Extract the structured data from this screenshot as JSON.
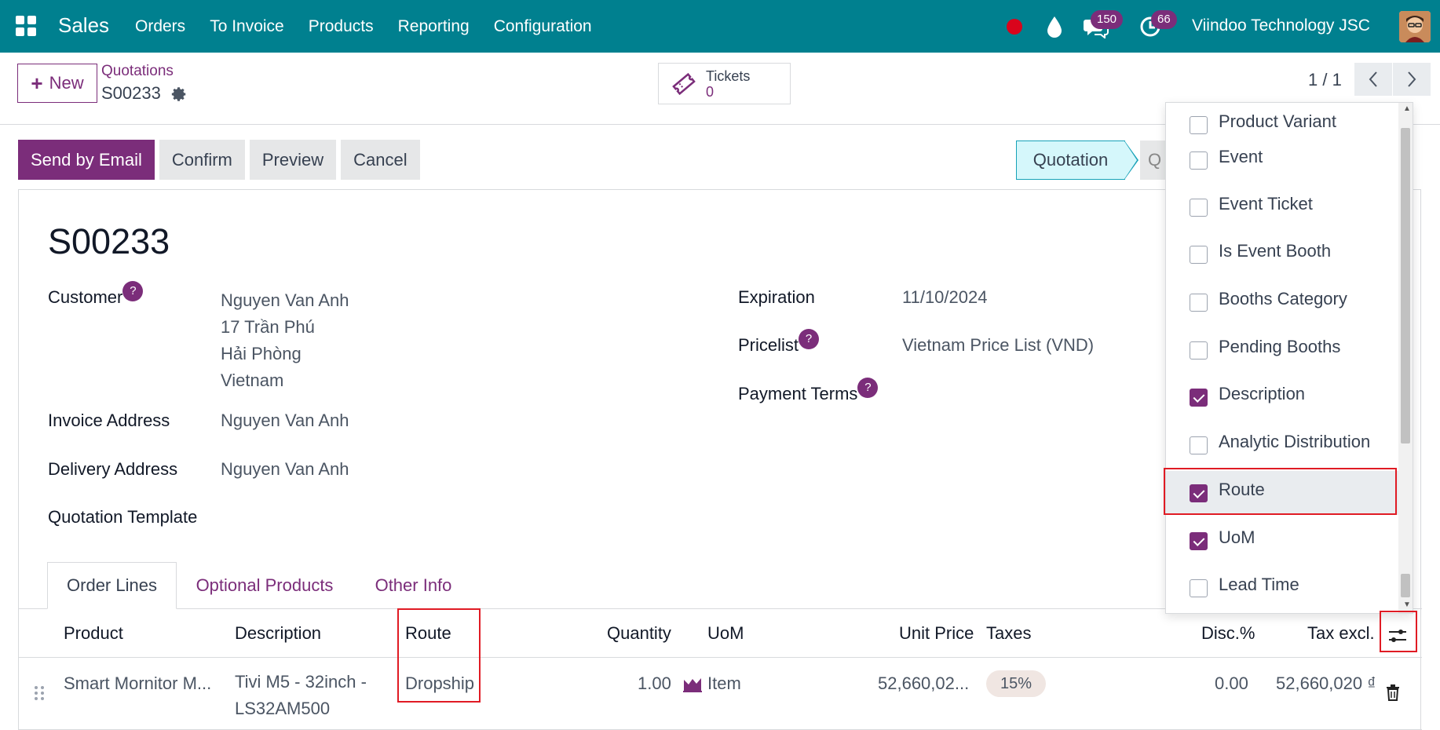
{
  "navbar": {
    "app_name": "Sales",
    "menu": [
      "Orders",
      "To Invoice",
      "Products",
      "Reporting",
      "Configuration"
    ],
    "chat_count": "150",
    "activity_count": "66",
    "company": "Viindoo Technology JSC"
  },
  "control": {
    "new_label": "New",
    "breadcrumb_parent": "Quotations",
    "breadcrumb_current": "S00233",
    "smart_button": {
      "label": "Tickets",
      "value": "0"
    },
    "pager": "1 / 1"
  },
  "actions": [
    "Send by Email",
    "Confirm",
    "Preview",
    "Cancel"
  ],
  "status": {
    "current": "Quotation",
    "next": "Q"
  },
  "form": {
    "title": "S00233",
    "customer_label": "Customer",
    "customer_lines": [
      "Nguyen Van Anh",
      "17 Trần Phú",
      "Hải Phòng",
      "Vietnam"
    ],
    "invoice_label": "Invoice Address",
    "invoice_value": "Nguyen Van Anh",
    "delivery_label": "Delivery Address",
    "delivery_value": "Nguyen Van Anh",
    "template_label": "Quotation Template",
    "expiration_label": "Expiration",
    "expiration_value": "11/10/2024",
    "pricelist_label": "Pricelist",
    "pricelist_value": "Vietnam Price List (VND)",
    "payment_terms_label": "Payment Terms",
    "help_mark": "?"
  },
  "tabs": [
    "Order Lines",
    "Optional Products",
    "Other Info"
  ],
  "table": {
    "headers": {
      "product": "Product",
      "description": "Description",
      "route": "Route",
      "quantity": "Quantity",
      "uom": "UoM",
      "unit_price": "Unit Price",
      "taxes": "Taxes",
      "discount": "Disc.%",
      "tax_excl": "Tax excl."
    },
    "rows": [
      {
        "product": "Smart Mornitor M...",
        "description_line1": "Tivi M5 - 32inch -",
        "description_line2": "LS32AM500",
        "route": "Dropship",
        "quantity": "1.00",
        "uom": "Item",
        "unit_price": "52,660,02...",
        "taxes": "15%",
        "discount": "0.00",
        "tax_excl": "52,660,020 ₫"
      }
    ]
  },
  "optional_columns": [
    {
      "label": "Product Variant",
      "checked": false
    },
    {
      "label": "Event",
      "checked": false
    },
    {
      "label": "Event Ticket",
      "checked": false
    },
    {
      "label": "Is Event Booth",
      "checked": false
    },
    {
      "label": "Booths Category",
      "checked": false
    },
    {
      "label": "Pending Booths",
      "checked": false
    },
    {
      "label": "Description",
      "checked": true
    },
    {
      "label": "Analytic Distribution",
      "checked": false
    },
    {
      "label": "Route",
      "checked": true
    },
    {
      "label": "UoM",
      "checked": true
    },
    {
      "label": "Lead Time",
      "checked": false
    }
  ],
  "colors": {
    "brand": "#00808f",
    "primary": "#7b2d7a",
    "highlight": "#e01b24"
  }
}
